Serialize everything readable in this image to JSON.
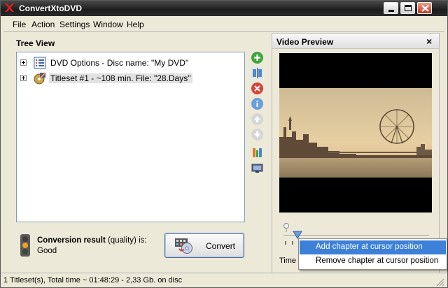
{
  "window": {
    "title": "ConvertXtoDVD"
  },
  "menu": [
    "File",
    "Action",
    "Settings",
    "Window",
    "Help"
  ],
  "tree": {
    "title": "Tree View",
    "items": [
      {
        "label": "DVD Options - Disc name: \"My DVD\"",
        "icon": "dvd-options-icon"
      },
      {
        "label": "Titleset #1 - ~108 min. File: \"28.Days\"",
        "icon": "titleset-icon"
      }
    ]
  },
  "toolbar": [
    {
      "name": "add-icon",
      "color": "#3fa53f"
    },
    {
      "name": "split-icon",
      "color": "#4f88c9"
    },
    {
      "name": "remove-icon",
      "color": "#d8423b"
    },
    {
      "name": "info-icon",
      "color": "#4f88c9"
    },
    {
      "name": "move-up-icon",
      "color": "#c7c7c7"
    },
    {
      "name": "move-down-icon",
      "color": "#c7c7c7"
    },
    {
      "name": "tools-icon",
      "color": "#d97b2a"
    },
    {
      "name": "screen-icon",
      "color": "#5f6f8c"
    }
  ],
  "conversion": {
    "label_bold": "Conversion result",
    "label_rest": " (quality) is:",
    "value": "Good"
  },
  "convert_button": {
    "label": "Convert"
  },
  "preview": {
    "title": "Video Preview",
    "close": "×",
    "time_label": "Time"
  },
  "context_menu": {
    "items": [
      {
        "label": "Add chapter at cursor position",
        "active": true
      },
      {
        "label": "Remove chapter at cursor position",
        "active": false
      }
    ]
  },
  "status": {
    "text": "1 Titleset(s), Total time ~ 01:48:29 - 2,33 Gb. on disc"
  }
}
